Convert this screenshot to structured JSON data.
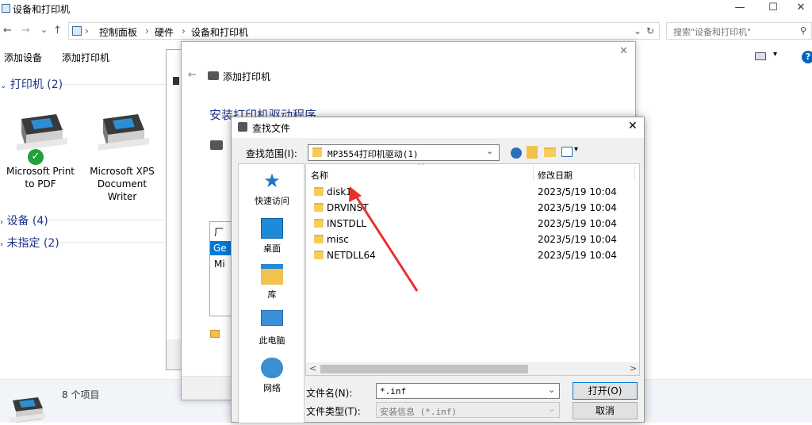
{
  "window": {
    "title": "设备和打印机",
    "minimize": "—",
    "maximize": "☐",
    "close": "✕"
  },
  "address": {
    "back": "←",
    "forward": "→",
    "recent": "⌄",
    "up": "↑",
    "crumbs": [
      "控制面板",
      "硬件",
      "设备和打印机"
    ],
    "sep": "›",
    "dropdown": "⌄",
    "refresh": "↻",
    "search_placeholder": "搜索\"设备和打印机\"",
    "search_icon": "⚲"
  },
  "commands": {
    "add_device": "添加设备",
    "add_printer": "添加打印机",
    "view": "▾",
    "help": "?"
  },
  "groups": {
    "printers": "打印机 (2)",
    "devices": "设备 (4)",
    "unspecified": "未指定 (2)"
  },
  "printers": [
    {
      "line1": "Microsoft Print",
      "line2": "to PDF",
      "line3": "",
      "default": true
    },
    {
      "line1": "Microsoft XPS",
      "line2": "Document",
      "line3": "Writer",
      "default": false
    }
  ],
  "status": {
    "count": "8 个项目"
  },
  "wizard": {
    "close": "✕",
    "back": "←",
    "title": "添加打印机",
    "heading": "安装打印机驱动程序",
    "partial_list_head": "厂",
    "partial_list_sel": "Ge",
    "partial_list_item": "Mi"
  },
  "dialog": {
    "title": "查找文件",
    "close": "✕",
    "look_in_label": "查找范围(I):",
    "look_in_value": "MP3554打印机驱动(1)",
    "places": [
      "快速访问",
      "桌面",
      "库",
      "此电脑",
      "网络"
    ],
    "col_name": "名称",
    "col_date": "修改日期",
    "col_cut": "|",
    "sort_arrow": "^",
    "files": [
      {
        "name": "disk1",
        "date": "2023/5/19 10:04"
      },
      {
        "name": "DRVINST",
        "date": "2023/5/19 10:04"
      },
      {
        "name": "INSTDLL",
        "date": "2023/5/19 10:04"
      },
      {
        "name": "misc",
        "date": "2023/5/19 10:04"
      },
      {
        "name": "NETDLL64",
        "date": "2023/5/19 10:04"
      }
    ],
    "file_name_label": "文件名(N):",
    "file_name_value": "*.inf",
    "file_type_label": "文件类型(T):",
    "file_type_value": "安装信息 (*.inf)",
    "open": "打开(O)",
    "cancel": "取消",
    "scroll_left": "<",
    "scroll_right": ">"
  },
  "colors": {
    "accent": "#1e3287",
    "arrow": "#e8312f",
    "folder": "#f6cc5a",
    "help": "#0067c0"
  }
}
